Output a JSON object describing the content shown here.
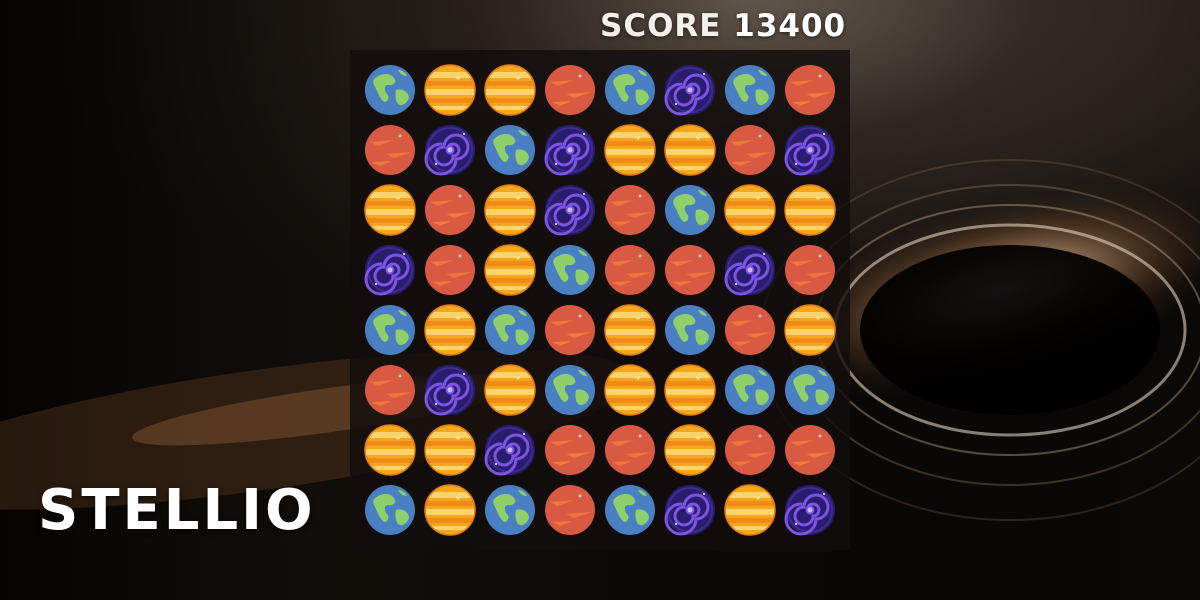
{
  "game": {
    "title": "STELLIO",
    "score_label": "SCORE",
    "score_value": "13400"
  },
  "board": {
    "rows": 8,
    "cols": 8,
    "grid": [
      [
        "earth",
        "jupiter",
        "jupiter",
        "mars",
        "earth",
        "galaxy",
        "earth",
        "mars"
      ],
      [
        "mars",
        "galaxy",
        "earth",
        "galaxy",
        "jupiter",
        "jupiter",
        "mars",
        "galaxy"
      ],
      [
        "jupiter",
        "mars",
        "jupiter",
        "galaxy",
        "mars",
        "earth",
        "jupiter",
        "jupiter"
      ],
      [
        "galaxy",
        "mars",
        "jupiter",
        "earth",
        "mars",
        "mars",
        "galaxy",
        "mars"
      ],
      [
        "earth",
        "jupiter",
        "earth",
        "mars",
        "jupiter",
        "earth",
        "mars",
        "jupiter"
      ],
      [
        "mars",
        "galaxy",
        "jupiter",
        "earth",
        "jupiter",
        "jupiter",
        "earth",
        "earth"
      ],
      [
        "jupiter",
        "jupiter",
        "galaxy",
        "mars",
        "mars",
        "jupiter",
        "mars",
        "mars"
      ],
      [
        "earth",
        "jupiter",
        "earth",
        "mars",
        "earth",
        "galaxy",
        "jupiter",
        "galaxy"
      ]
    ]
  },
  "tile_icons": {
    "earth": "earth-planet-icon",
    "jupiter": "jupiter-planet-icon",
    "mars": "mars-planet-icon",
    "galaxy": "spiral-galaxy-icon"
  },
  "colors": {
    "earth_ocean": "#4a7fc1",
    "earth_land": "#8fcf6a",
    "jupiter_band_a": "#f7a71c",
    "jupiter_band_b": "#f08a19",
    "jupiter_band_c": "#ffd36b",
    "mars": "#d95a43",
    "mars_streak": "#f0763a",
    "galaxy_bg": "#2a1d6e",
    "galaxy_arm": "#7d55e6"
  }
}
